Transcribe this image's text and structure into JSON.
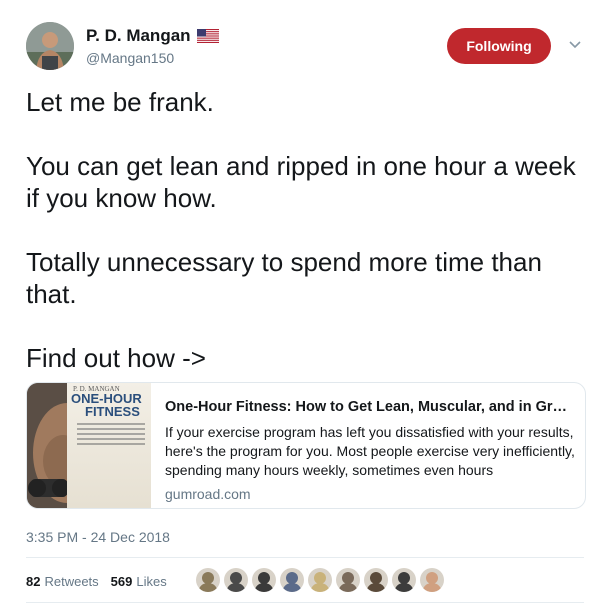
{
  "user": {
    "display_name": "P. D. Mangan",
    "handle": "@Mangan150",
    "flag": "us-flag-icon"
  },
  "follow_button": {
    "label": "Following",
    "color": "#c0282d"
  },
  "tweet": {
    "text": "Let me be frank.\n\nYou can get lean and ripped in one hour a week if you know how.\n\nTotally unnecessary to spend more time than that.\n\nFind out how ->"
  },
  "card": {
    "thumbnail": {
      "author": "P. D. MANGAN",
      "title_line1": "ONE-HOUR",
      "title_line2": "FITNESS"
    },
    "title": "One-Hour Fitness: How to Get Lean, Muscular, and in Great...",
    "description": "If your exercise program has left you dissatisfied with your results, here's the program for you. Most people exercise very inefficiently, spending many hours weekly, sometimes even hours",
    "domain": "gumroad.com"
  },
  "timestamp": "3:35 PM - 24 Dec 2018",
  "stats": {
    "retweets_count": "82",
    "retweets_label": "Retweets",
    "likes_count": "569",
    "likes_label": "Likes"
  },
  "likers": [
    {
      "color": "#8a7a5a"
    },
    {
      "color": "#4a4a4a"
    },
    {
      "color": "#3a3a3a"
    },
    {
      "color": "#5b6b8a"
    },
    {
      "color": "#c9b27a"
    },
    {
      "color": "#7a6a5a"
    },
    {
      "color": "#5a4a3a"
    },
    {
      "color": "#3c3c3c"
    },
    {
      "color": "#d0a080"
    }
  ]
}
